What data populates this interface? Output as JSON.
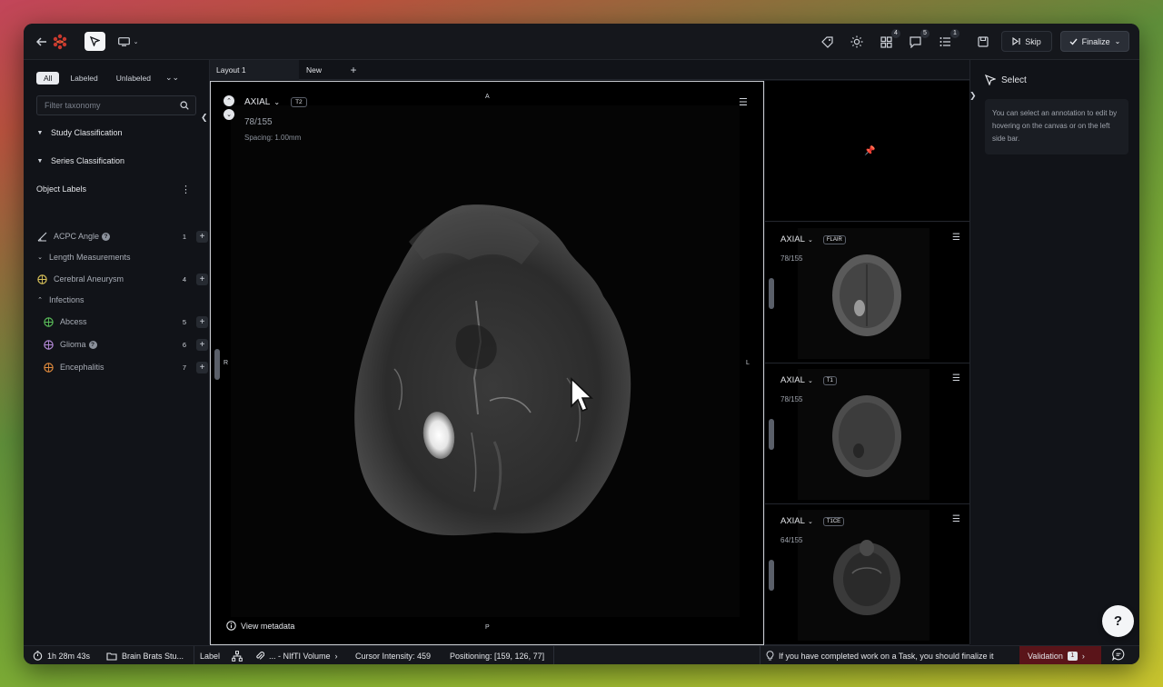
{
  "toolbar": {
    "topic_badges": {
      "layout": "4",
      "comments": "5",
      "tasks": "1"
    },
    "skip_label": "Skip",
    "finalize_label": "Finalize"
  },
  "sidebar": {
    "filters": [
      "All",
      "Labeled",
      "Unlabeled"
    ],
    "active_filter": "All",
    "search_placeholder": "Filter taxonomy",
    "sections": [
      "Study Classification",
      "Series Classification"
    ],
    "object_labels_title": "Object Labels",
    "items": [
      {
        "name": "ACPC Angle",
        "count": "1",
        "help": true,
        "color": "#cfd3da"
      },
      {
        "name": "Cerebral Aneurysm",
        "count": "4",
        "help": false,
        "color": "#d9c25a"
      },
      {
        "name": "Abcess",
        "count": "5",
        "help": false,
        "color": "#5bbf5a"
      },
      {
        "name": "Glioma",
        "count": "6",
        "help": true,
        "color": "#b58ad8"
      },
      {
        "name": "Encephalitis",
        "count": "7",
        "help": false,
        "color": "#e08a3c"
      }
    ],
    "groups": [
      "Length Measurements",
      "Infections"
    ]
  },
  "tabs": [
    "Layout 1",
    "New"
  ],
  "viewport": {
    "sequence": "AXIAL",
    "tag": "T2",
    "slice": "78/155",
    "spacing": "Spacing: 1.00mm",
    "orient_top": "A",
    "orient_bottom": "P",
    "orient_left": "R",
    "orient_right": "L",
    "metadata_label": "View metadata"
  },
  "thumbnails": [
    {
      "sequence": "AXIAL",
      "tag": "FLAIR",
      "slice": "78/155"
    },
    {
      "sequence": "AXIAL",
      "tag": "T1",
      "slice": "78/155"
    },
    {
      "sequence": "AXIAL",
      "tag": "T1CE",
      "slice": "64/155"
    }
  ],
  "inspector": {
    "title": "Select",
    "note": "You can select an annotation to edit by hovering on the canvas or on the left side bar."
  },
  "statusbar": {
    "timer": "1h 28m 43s",
    "project": "Brain Brats Stu...",
    "label": "Label",
    "volume": "... - NIfTI Volume",
    "cursor_intensity": "Cursor Intensity: 459",
    "positioning": "Positioning: [159, 126, 77]",
    "hint": "If you have completed work on a Task, you should finalize it",
    "validation_label": "Validation",
    "validation_count": "1"
  },
  "colors": {
    "accent_validation": "#5a1419",
    "background": "#111318"
  }
}
